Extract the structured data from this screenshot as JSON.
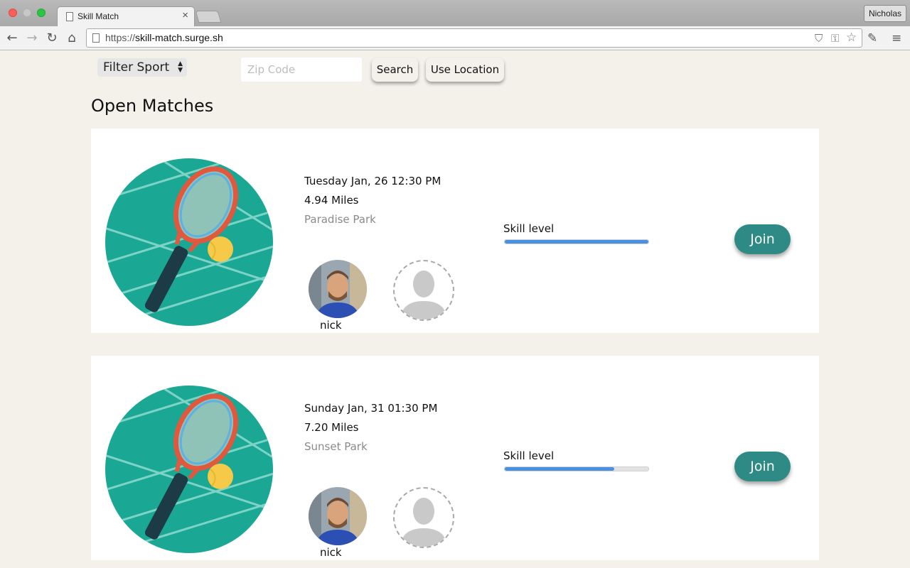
{
  "browser": {
    "tab_title": "Skill Match",
    "tab_close": "×",
    "profile_name": "Nicholas",
    "url_scheme": "https://",
    "url_host": "skill-match.surge.sh"
  },
  "toolbar": {
    "filter_label": "Filter Sport",
    "zip_placeholder": "Zip Code",
    "search_label": "Search",
    "location_label": "Use Location"
  },
  "section_title": "Open Matches",
  "matches": [
    {
      "datetime": "Tuesday Jan, 26 12:30 PM",
      "distance": "4.94 Miles",
      "location": "Paradise Park",
      "skill_label": "Skill level",
      "skill_level": 1.0,
      "player_name": "nick",
      "join_label": "Join"
    },
    {
      "datetime": "Sunday Jan, 31 01:30 PM",
      "distance": "7.20 Miles",
      "location": "Sunset Park",
      "skill_label": "Skill level",
      "skill_level": 0.76,
      "player_name": "nick",
      "join_label": "Join"
    }
  ],
  "colors": {
    "accent": "#2e8a84",
    "skill_fill": "#4a90e2",
    "court": "#1aa894",
    "background": "#f4f1eb"
  },
  "icons": {
    "sport": "tennis-racket-ball-icon",
    "empty_player": "person-silhouette-icon"
  }
}
